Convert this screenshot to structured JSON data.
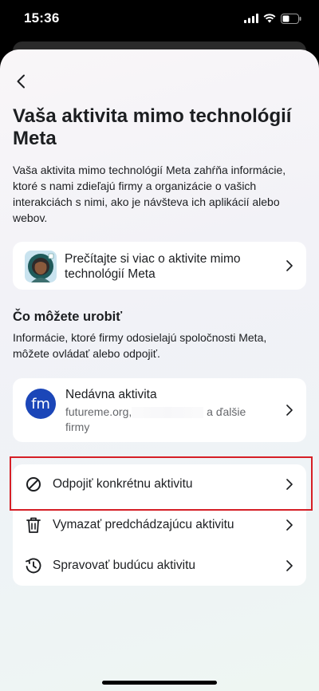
{
  "status_bar": {
    "time": "15:36"
  },
  "header": {
    "back_icon": "chevron-left-icon"
  },
  "page": {
    "title": "Vaša aktivita mimo technológií Meta",
    "description": "Vaša aktivita mimo technológií Meta zahŕňa informácie, ktoré s nami zdieľajú firmy a organizácie o vašich interakciách s nimi, ako je návšteva ich aplikácií alebo webov."
  },
  "learn_more": {
    "label": "Prečítajte si viac o aktivite mimo technológií Meta"
  },
  "what_you_can_do": {
    "title": "Čo môžete urobiť",
    "description": "Informácie, ktoré firmy odosielajú spoločnosti Meta, môžete ovládať alebo odpojiť."
  },
  "recent_activity": {
    "logo_text": "fm",
    "title": "Nedávna aktivita",
    "subtitle_start": "futureme.org,",
    "subtitle_end": "a ďalšie firmy"
  },
  "actions": [
    {
      "label": "Odpojiť konkrétnu aktivitu",
      "icon": "block-icon"
    },
    {
      "label": "Vymazať predchádzajúcu aktivitu",
      "icon": "trash-icon"
    },
    {
      "label": "Spravovať budúcu aktivitu",
      "icon": "history-clock-icon"
    }
  ],
  "colors": {
    "highlight": "#d61f26",
    "logo_bg": "#1b46b8"
  }
}
